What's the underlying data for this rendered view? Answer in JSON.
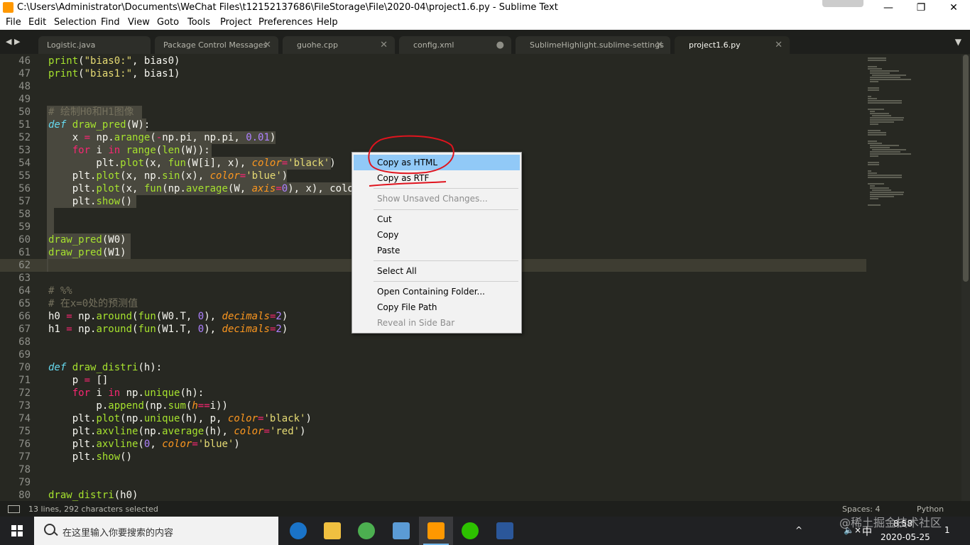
{
  "window": {
    "title": "C:\\Users\\Administrator\\Documents\\WeChat Files\\t12152137686\\FileStorage\\File\\2020-04\\project1.6.py - Sublime Text",
    "minimize": "—",
    "maximize": "❐",
    "close": "✕"
  },
  "menu": [
    "File",
    "Edit",
    "Selection",
    "Find",
    "View",
    "Goto",
    "Tools",
    "Project",
    "Preferences",
    "Help"
  ],
  "tabs": [
    {
      "label": "Logistic.java",
      "close": ""
    },
    {
      "label": "Package Control Messages",
      "close": "✕"
    },
    {
      "label": "guohe.cpp",
      "close": "✕"
    },
    {
      "label": "config.xml",
      "close": "●"
    },
    {
      "label": "SublimeHighlight.sublime-settings",
      "close": "✕"
    },
    {
      "label": "project1.6.py",
      "close": "✕"
    }
  ],
  "tab_nav": {
    "arrows": "◀ ▶",
    "dropdown": "▼"
  },
  "editor": {
    "line_numbers": [
      "46",
      "47",
      "48",
      "49",
      "50",
      "51",
      "52",
      "53",
      "54",
      "55",
      "56",
      "57",
      "58",
      "59",
      "60",
      "61",
      "62",
      "63",
      "64",
      "65",
      "66",
      "67",
      "68",
      "69",
      "70",
      "71",
      "72",
      "73",
      "74",
      "75",
      "76",
      "77",
      "78",
      "79",
      "80"
    ],
    "selected_from": 50,
    "selected_to": 62,
    "current_line": 62,
    "lines": [
      "print(\"bias0:\", bias0)",
      "print(\"bias1:\", bias1)",
      "",
      "",
      "# 绘制H0和H1图像",
      "def draw_pred(W):",
      "    x = np.arange(-np.pi, np.pi, 0.01)",
      "    for i in range(len(W)):",
      "        plt.plot(x, fun(W[i], x), color='black')",
      "    plt.plot(x, np.sin(x), color='blue')",
      "    plt.plot(x, fun(np.average(W, axis=0), x), color",
      "    plt.show()",
      "",
      "",
      "draw_pred(W0)",
      "draw_pred(W1)",
      "",
      "",
      "# %%",
      "# 在x=0处的预测值",
      "h0 = np.around(fun(W0.T, 0), decimals=2)",
      "h1 = np.around(fun(W1.T, 0), decimals=2)",
      "",
      "",
      "def draw_distri(h):",
      "    p = []",
      "    for i in np.unique(h):",
      "        p.append(np.sum(h==i))",
      "    plt.plot(np.unique(h), p, color='black')",
      "    plt.axvline(np.average(h), color='red')",
      "    plt.axvline(0, color='blue')",
      "    plt.show()",
      "",
      "",
      "draw_distri(h0)"
    ]
  },
  "context_menu": {
    "items": [
      {
        "label": "Copy as HTML",
        "state": "highlighted"
      },
      {
        "label": "Copy as RTF",
        "state": "normal"
      },
      {
        "label": "Show Unsaved Changes...",
        "state": "disabled"
      },
      {
        "label": "Cut",
        "state": "normal"
      },
      {
        "label": "Copy",
        "state": "normal"
      },
      {
        "label": "Paste",
        "state": "normal"
      },
      {
        "label": "Select All",
        "state": "normal"
      },
      {
        "label": "Open Containing Folder...",
        "state": "normal"
      },
      {
        "label": "Copy File Path",
        "state": "normal"
      },
      {
        "label": "Reveal in Side Bar",
        "state": "disabled"
      }
    ],
    "annotation_color": "#e0141e"
  },
  "status": {
    "selection": "13 lines, 292 characters selected",
    "indent": "Spaces: 4",
    "syntax": "Python"
  },
  "taskbar": {
    "search_placeholder": "在这里输入你要搜索的内容",
    "apps": [
      "edge-icon",
      "file-explorer-icon",
      "browser-icon",
      "control-panel-icon",
      "sublime-text-icon",
      "wechat-icon",
      "word-icon"
    ],
    "tray": {
      "chevron": "^",
      "volume": "🔈×",
      "ime": "中",
      "time": "8:58",
      "date": "2020-05-25",
      "notification_count": "1"
    }
  },
  "watermark": "@稀土掘金技术社区",
  "colors": {
    "editor_bg": "#272822",
    "selection": "#49483e",
    "menu_highlight": "#91c9f7",
    "keyword": "#f92672",
    "function": "#a6e22e",
    "string": "#e6db74",
    "number": "#ae81ff"
  }
}
